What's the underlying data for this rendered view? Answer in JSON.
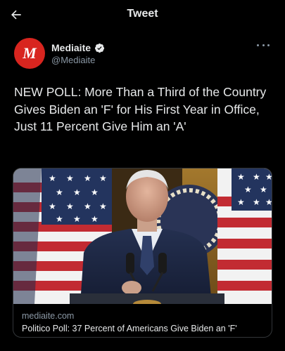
{
  "header": {
    "title": "Tweet",
    "back_icon": "arrow-left-icon"
  },
  "author": {
    "avatar_letter": "M",
    "avatar_color": "#d8251f",
    "display_name": "Mediaite",
    "handle": "@Mediaite",
    "verified": true,
    "verified_color": "#e7e9ea"
  },
  "tweet": {
    "text": "NEW POLL: More Than a Third of the Country Gives Biden an 'F' for His First Year in Office, Just 11 Percent Give Him an 'A'"
  },
  "card": {
    "domain": "mediaite.com",
    "title": "Politico Poll: 37 Percent of Americans Give Biden an 'F'"
  },
  "colors": {
    "background": "#000000",
    "text_primary": "#e7e9ea",
    "text_secondary": "#8b98a5",
    "border": "#333639"
  }
}
